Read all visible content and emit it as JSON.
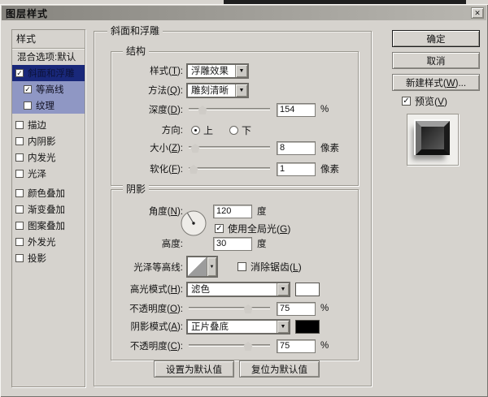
{
  "window": {
    "title": "图层样式",
    "close_glyph": "✕"
  },
  "sidebar": {
    "header": "样式",
    "items": [
      {
        "label": "混合选项:默认",
        "check": null
      },
      {
        "label": "斜面和浮雕",
        "check": "✓"
      },
      {
        "label": "等高线",
        "check": "✓"
      },
      {
        "label": "纹理",
        "check": ""
      },
      {
        "label": "描边",
        "check": ""
      },
      {
        "label": "内阴影",
        "check": ""
      },
      {
        "label": "内发光",
        "check": ""
      },
      {
        "label": "光泽",
        "check": ""
      },
      {
        "label": "颜色叠加",
        "check": ""
      },
      {
        "label": "渐变叠加",
        "check": ""
      },
      {
        "label": "图案叠加",
        "check": ""
      },
      {
        "label": "外发光",
        "check": ""
      },
      {
        "label": "投影",
        "check": ""
      }
    ]
  },
  "panel": {
    "title": "斜面和浮雕",
    "structure": {
      "legend": "结构",
      "style": {
        "label": "样式(T):",
        "value": "浮雕效果"
      },
      "technique": {
        "label": "方法(Q):",
        "value": "雕刻清晰"
      },
      "depth": {
        "label": "深度(D):",
        "value": "154",
        "unit": "%",
        "pos": 17
      },
      "direction": {
        "label": "方向:",
        "up": "上",
        "down": "下"
      },
      "size": {
        "label": "大小(Z):",
        "value": "8",
        "unit": "像素",
        "pos": 8
      },
      "soften": {
        "label": "软化(F):",
        "value": "1",
        "unit": "像素",
        "pos": 6
      }
    },
    "shading": {
      "legend": "阴影",
      "angle": {
        "label": "角度(N):",
        "value": "120",
        "unit": "度"
      },
      "global_light": {
        "label": "使用全局光(G)",
        "check": "✓"
      },
      "altitude": {
        "label": "高度:",
        "value": "30",
        "unit": "度"
      },
      "gloss_contour": {
        "label": "光泽等高线:"
      },
      "antialias": {
        "label": "消除锯齿(L)",
        "check": ""
      },
      "highlight_mode": {
        "label": "高光模式(H):",
        "value": "滤色",
        "swatch": "#ffffff"
      },
      "highlight_opacity": {
        "label": "不透明度(O):",
        "value": "75",
        "unit": "%",
        "pos": 73
      },
      "shadow_mode": {
        "label": "阴影模式(A):",
        "value": "正片叠底",
        "swatch": "#000000"
      },
      "shadow_opacity": {
        "label": "不透明度(C):",
        "value": "75",
        "unit": "%",
        "pos": 73
      }
    },
    "footer_buttons": {
      "make_default": "设置为默认值",
      "reset_default": "复位为默认值"
    }
  },
  "actions": {
    "ok": "确定",
    "cancel": "取消",
    "new_style": "新建样式(W)...",
    "preview": {
      "label": "预览(V)",
      "check": "✓"
    }
  }
}
